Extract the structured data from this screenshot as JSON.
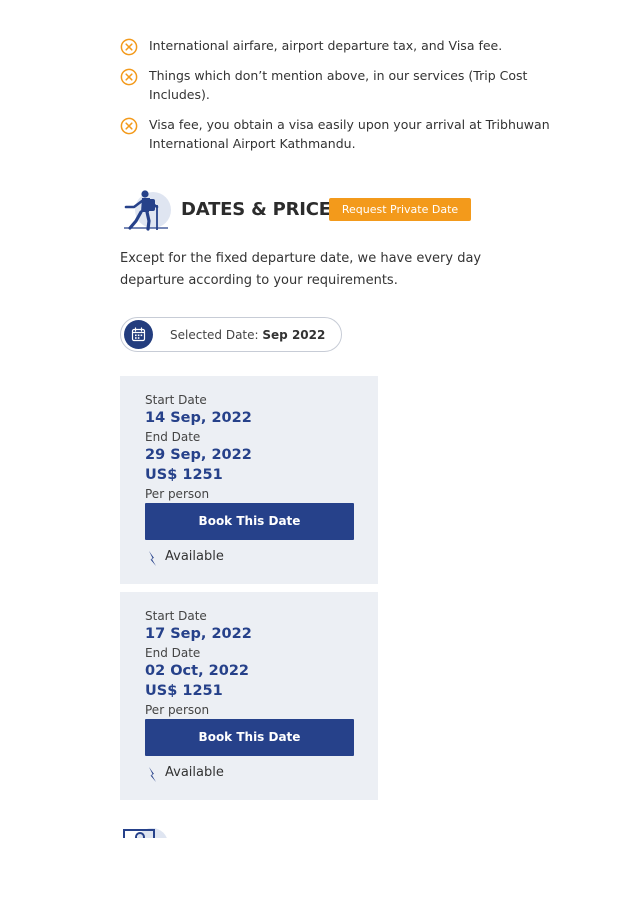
{
  "exclusions": [
    {
      "icon": "x-circle-icon",
      "text": "International airfare, airport departure tax, and Visa fee."
    },
    {
      "icon": "x-circle-icon",
      "text": "Things which don’t mention above, in our services (Trip Cost Includes)."
    },
    {
      "icon": "x-circle-icon",
      "text": "Visa fee, you obtain a visa easily upon your arrival at Tribhuwan International Airport Kathmandu."
    }
  ],
  "dates_section": {
    "icon": "hiker-icon",
    "title": "DATES & PRICE",
    "request_button": "Request Private Date",
    "intro": "Except for the fixed departure date, we have every day departure according to your requirements."
  },
  "selected_date": {
    "icon": "calendar-icon",
    "label": "Selected Date:",
    "value": "Sep 2022"
  },
  "departures": [
    {
      "start_label": "Start Date",
      "start_date": "14 Sep, 2022",
      "end_label": "End Date",
      "end_date": "29 Sep, 2022",
      "price": "US$ 1251",
      "per_person": "Per person",
      "book_label": "Book This Date",
      "status": "Available"
    },
    {
      "start_label": "Start Date",
      "start_date": "17 Sep, 2022",
      "end_label": "End Date",
      "end_date": "02 Oct, 2022",
      "price": "US$ 1251",
      "per_person": "Per person",
      "book_label": "Book This Date",
      "status": "Available"
    }
  ],
  "colors": {
    "accent_orange": "#f39a1b",
    "brand_blue": "#26418a",
    "card_bg": "#eceff4"
  }
}
